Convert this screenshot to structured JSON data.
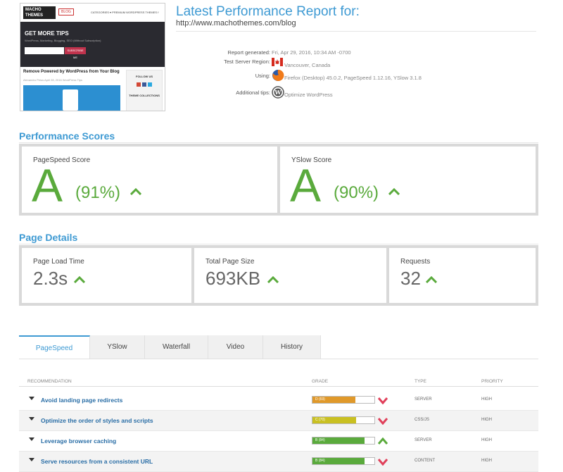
{
  "thumbnail": {
    "logo_text": "MACHO THEMES",
    "blog_badge": "BLOG",
    "nav_text": "CATEGORIES ▾   PREMIUM WORDPRESS THEMES   f",
    "hero_title": "GET MORE TIPS",
    "hero_subtitle": "WordPress, Marketing, Blogging, SEO (Without Subscription)",
    "subscribe_label": "SUBSCRIBE ME",
    "post_title": "Remove Powered by WordPress from Your Blog",
    "post_meta": "Alexandru Peius   April 28, 2016   WordPress Tips",
    "follow_label": "FOLLOW US",
    "collections_label": "THEME COLLECTIONS"
  },
  "report": {
    "title": "Latest Performance Report for:",
    "url": "http://www.machothemes.com/blog",
    "meta": [
      {
        "label": "Report generated:",
        "value": "Fri, Apr 29, 2016, 10:34 AM -0700",
        "icon": "none"
      },
      {
        "label": "Test Server Region:",
        "value": "Vancouver, Canada",
        "icon": "canada-flag-icon"
      },
      {
        "label": "Using:",
        "value": "Firefox (Desktop) 45.0.2, PageSpeed 1.12.16, YSlow 3.1.8",
        "icon": "firefox-icon"
      },
      {
        "label": "Additional tips:",
        "value": "Optimize WordPress",
        "icon": "wordpress-icon"
      }
    ]
  },
  "scores": {
    "title": "Performance Scores",
    "pagespeed": {
      "label": "PageSpeed Score",
      "grade": "A",
      "percent": "(91%)"
    },
    "yslow": {
      "label": "YSlow Score",
      "grade": "A",
      "percent": "(90%)"
    }
  },
  "details": {
    "title": "Page Details",
    "items": [
      {
        "label": "Page Load Time",
        "value": "2.3s"
      },
      {
        "label": "Total Page Size",
        "value": "693KB"
      },
      {
        "label": "Requests",
        "value": "32"
      }
    ]
  },
  "tabs": [
    "PageSpeed",
    "YSlow",
    "Waterfall",
    "Video",
    "History"
  ],
  "table": {
    "headers": {
      "recommendation": "RECOMMENDATION",
      "grade": "GRADE",
      "type": "TYPE",
      "priority": "PRIORITY"
    },
    "rows": [
      {
        "recommendation": "Avoid landing page redirects",
        "grade": "D (69)",
        "grade_value": 69,
        "color": "#e0992a",
        "trend": "down",
        "type": "SERVER",
        "priority": "HIGH"
      },
      {
        "recommendation": "Optimize the order of styles and scripts",
        "grade": "C (70)",
        "grade_value": 70,
        "color": "#c9c021",
        "trend": "down",
        "type": "CSS/JS",
        "priority": "HIGH"
      },
      {
        "recommendation": "Leverage browser caching",
        "grade": "B (84)",
        "grade_value": 84,
        "color": "#5aaa3c",
        "trend": "up",
        "type": "SERVER",
        "priority": "HIGH"
      },
      {
        "recommendation": "Serve resources from a consistent URL",
        "grade": "B (84)",
        "grade_value": 84,
        "color": "#5aaa3c",
        "trend": "down",
        "type": "CONTENT",
        "priority": "HIGH"
      }
    ]
  },
  "colors": {
    "accent": "#3e9ad3",
    "good": "#5aaa3c",
    "bad": "#e0405a"
  }
}
